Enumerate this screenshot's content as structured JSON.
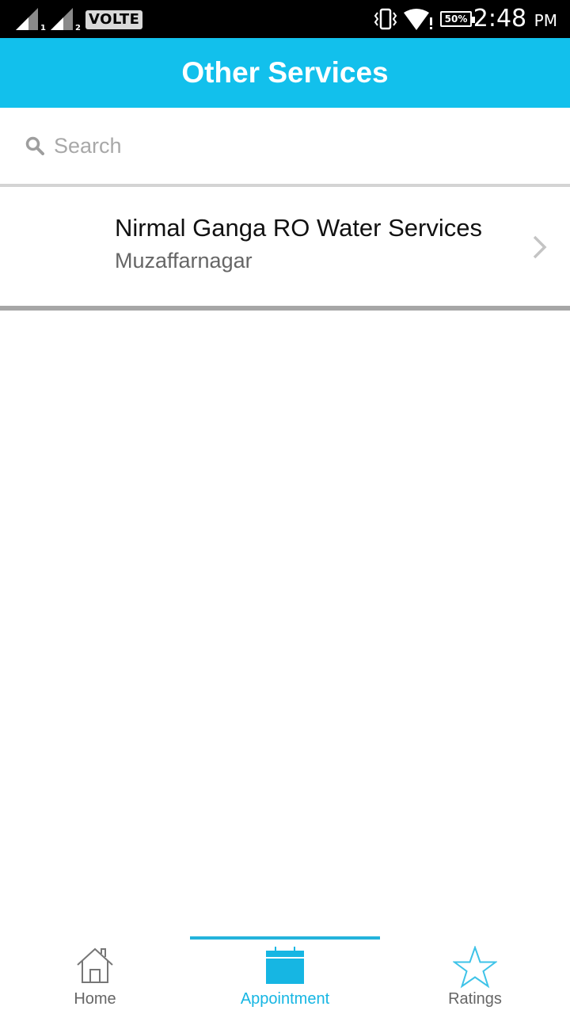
{
  "status_bar": {
    "sim1_label": "1",
    "sim2_label": "2",
    "volte": "VOLTE",
    "battery": "50%",
    "time": "2:48",
    "ampm": "PM",
    "icons": [
      "signal-icon",
      "volte-icon",
      "vibrate-icon",
      "wifi-icon",
      "battery-icon"
    ]
  },
  "app_bar": {
    "title": "Other Services",
    "color": "#12c0ec"
  },
  "search": {
    "placeholder": "Search",
    "value": "",
    "icon": "search-icon"
  },
  "services": [
    {
      "name": "Nirmal Ganga RO Water Services",
      "location": "Muzaffarnagar",
      "icon": "chevron-right-icon"
    }
  ],
  "bottom_nav": {
    "items": [
      {
        "label": "Home",
        "icon": "home-icon",
        "active": false
      },
      {
        "label": "Appointment",
        "icon": "calendar-icon",
        "active": true
      },
      {
        "label": "Ratings",
        "icon": "star-icon",
        "active": false
      }
    ],
    "active_color": "#16b6e3"
  }
}
